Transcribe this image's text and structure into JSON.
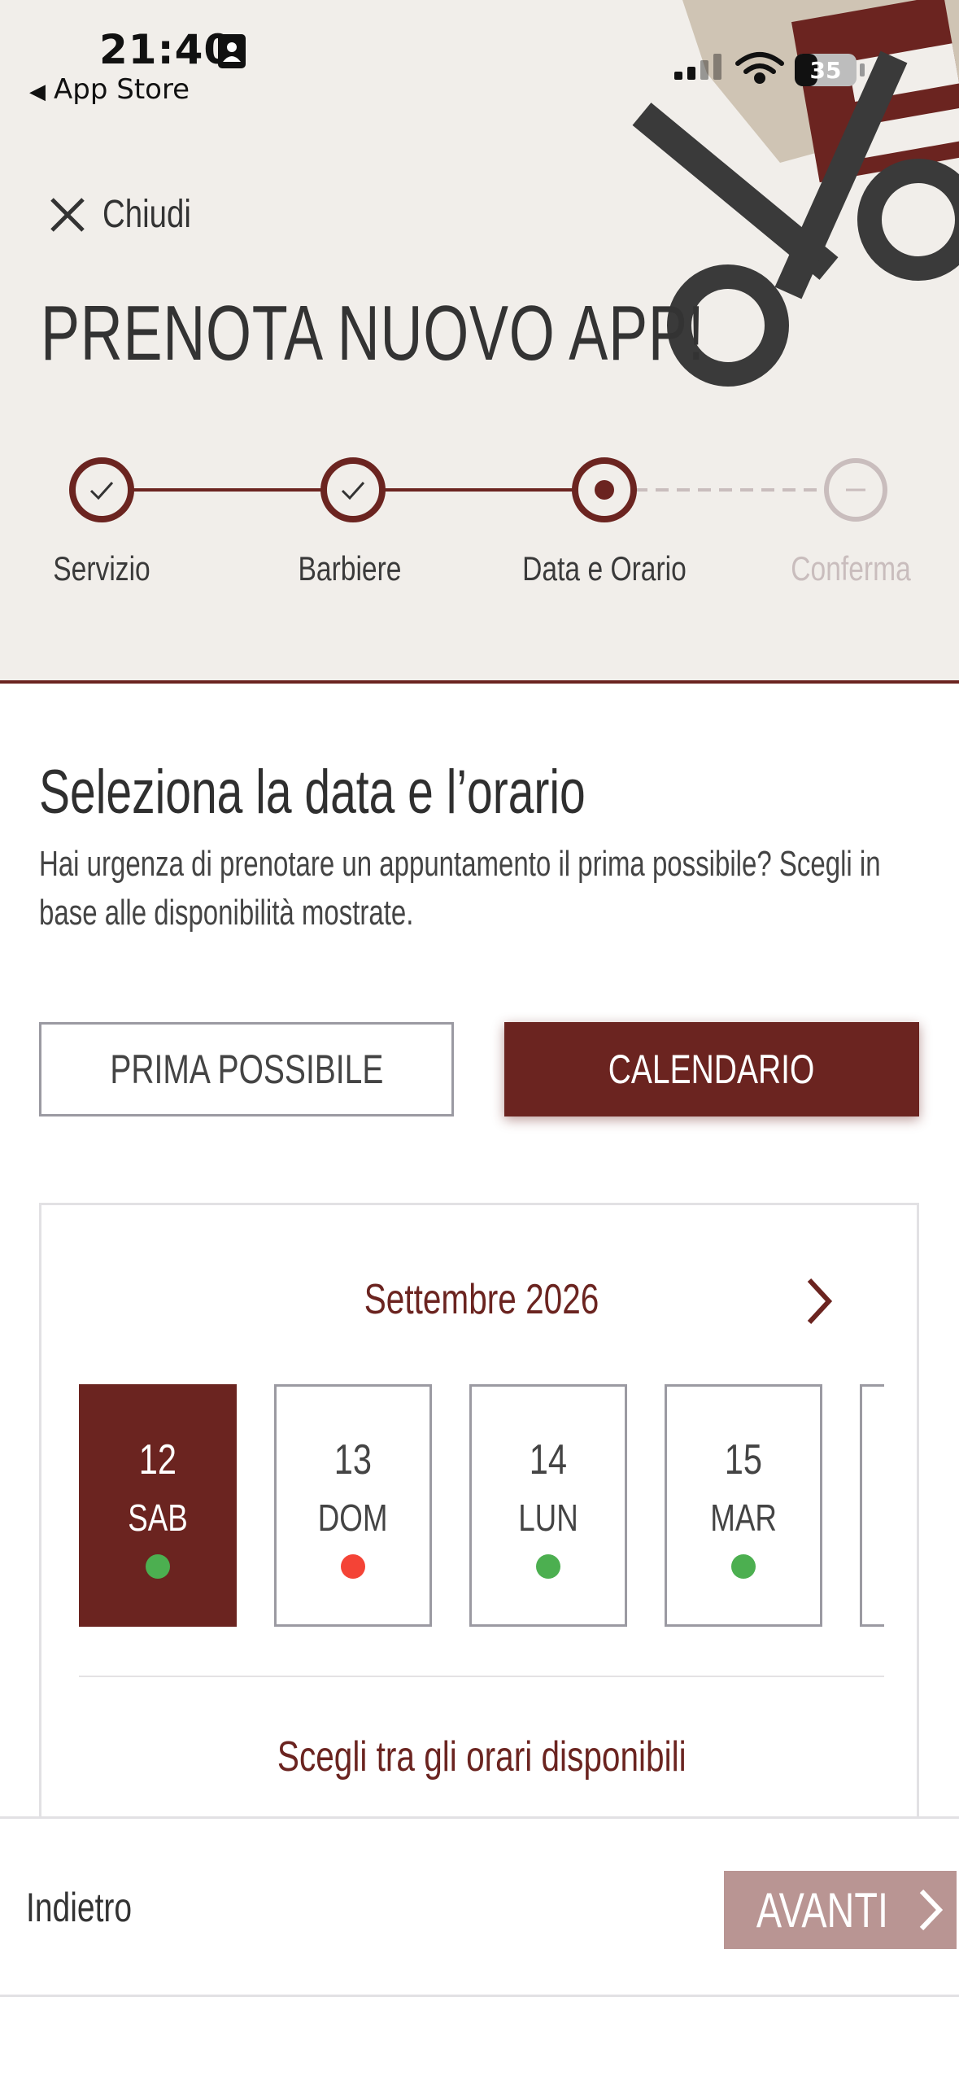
{
  "status_bar": {
    "time": "21:40",
    "back_label": "App Store",
    "battery": "35"
  },
  "header": {
    "close_label": "Chiudi",
    "title": "PRENOTA NUOVO APP!"
  },
  "steps": [
    {
      "label": "Servizio",
      "state": "done"
    },
    {
      "label": "Barbiere",
      "state": "done"
    },
    {
      "label": "Data e Orario",
      "state": "current"
    },
    {
      "label": "Conferma",
      "state": "upcoming"
    }
  ],
  "content": {
    "title": "Seleziona la data e l’orario",
    "description": "Hai urgenza di prenotare un appuntamento il prima possibile? Scegli in base alle disponibilità mostrate."
  },
  "mode_buttons": {
    "first_available": "PRIMA POSSIBILE",
    "calendar": "CALENDARIO",
    "selected": "calendar"
  },
  "calendar": {
    "month_label": "Settembre 2026",
    "days": [
      {
        "num": "12",
        "name": "SAB",
        "availability": "available",
        "selected": true
      },
      {
        "num": "13",
        "name": "DOM",
        "availability": "unavailable",
        "selected": false
      },
      {
        "num": "14",
        "name": "LUN",
        "availability": "available",
        "selected": false
      },
      {
        "num": "15",
        "name": "MAR",
        "availability": "available",
        "selected": false
      }
    ],
    "slots_title": "Scegli tra gli orari disponibili"
  },
  "footer": {
    "back_label": "Indietro",
    "next_label": "AVANTI"
  },
  "colors": {
    "brand": "#6b2420",
    "available": "#4caf50",
    "unavailable": "#f44336",
    "header_bg": "#f1eeea",
    "next_disabled": "#b99593"
  }
}
